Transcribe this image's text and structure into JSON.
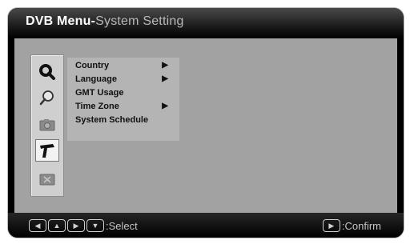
{
  "header": {
    "title_main": "DVB Menu-",
    "title_sub": "System Setting"
  },
  "menu": {
    "items": [
      {
        "label": "Country",
        "has_submenu": true
      },
      {
        "label": "Language",
        "has_submenu": true
      },
      {
        "label": "GMT Usage",
        "has_submenu": false
      },
      {
        "label": "Time Zone",
        "has_submenu": true
      },
      {
        "label": "System Schedule",
        "has_submenu": false
      }
    ],
    "submenu_arrow": "▶"
  },
  "icons": [
    {
      "name": "search-magnifier-icon",
      "selected": false
    },
    {
      "name": "zoom-search-icon",
      "selected": false
    },
    {
      "name": "camera-icon",
      "selected": false
    },
    {
      "name": "tools-icon",
      "selected": true
    },
    {
      "name": "delete-box-icon",
      "selected": false
    }
  ],
  "footer": {
    "nav_keys": [
      "◀",
      "▲",
      "▶",
      "▼"
    ],
    "select_label": ":Select",
    "confirm_key": "▶",
    "confirm_label": ":Confirm"
  },
  "colors": {
    "panel": "#a2a2a2",
    "menu_bg": "#b4b4b4",
    "header": "#141414"
  }
}
